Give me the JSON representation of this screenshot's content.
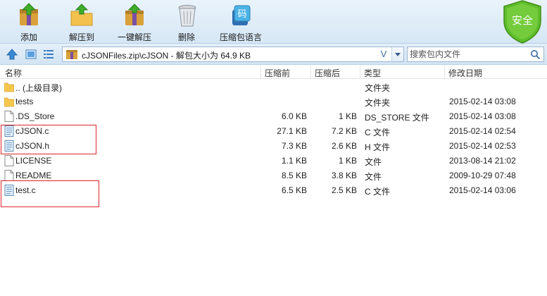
{
  "toolbar": {
    "add_label": "添加",
    "extract_to_label": "解压到",
    "one_click_extract_label": "一键解压",
    "delete_label": "删除",
    "zip_lang_label": "压缩包语言",
    "zip_lang_badge": "码",
    "safe_label": "安全"
  },
  "address": {
    "path": "cJSONFiles.zip\\cJSON - 解包大小为 64.9 KB",
    "chevron": "V"
  },
  "search": {
    "placeholder": "搜索包内文件"
  },
  "columns": {
    "name": "名称",
    "size": "压缩前",
    "packed": "压缩后",
    "type": "类型",
    "modified": "修改日期"
  },
  "files": [
    {
      "name": ".. (上级目录)",
      "size": "",
      "packed": "",
      "type": "文件夹",
      "modified": "",
      "icon": "folder-icon"
    },
    {
      "name": "tests",
      "size": "",
      "packed": "",
      "type": "文件夹",
      "modified": "2015-02-14 03:08",
      "icon": "folder-icon"
    },
    {
      "name": ".DS_Store",
      "size": "6.0 KB",
      "packed": "1 KB",
      "type": "DS_STORE 文件",
      "modified": "2015-02-14 03:08",
      "icon": "file-icon"
    },
    {
      "name": "cJSON.c",
      "size": "27.1 KB",
      "packed": "7.2 KB",
      "type": "C 文件",
      "modified": "2015-02-14 02:54",
      "icon": "c-file-icon"
    },
    {
      "name": "cJSON.h",
      "size": "7.3 KB",
      "packed": "2.6 KB",
      "type": "H 文件",
      "modified": "2015-02-14 02:53",
      "icon": "c-file-icon"
    },
    {
      "name": "LICENSE",
      "size": "1.1 KB",
      "packed": "1 KB",
      "type": "文件",
      "modified": "2013-08-14 21:02",
      "icon": "file-icon"
    },
    {
      "name": "README",
      "size": "8.5 KB",
      "packed": "3.8 KB",
      "type": "文件",
      "modified": "2009-10-29 07:48",
      "icon": "file-icon"
    },
    {
      "name": "test.c",
      "size": "6.5 KB",
      "packed": "2.5 KB",
      "type": "C 文件",
      "modified": "2015-02-14 03:06",
      "icon": "c-file-icon"
    }
  ],
  "colors": {
    "accent": "#3a6ea5",
    "highlight": "#d9262d",
    "safe": "#5fbd2b",
    "folder": "#f5c74d"
  }
}
